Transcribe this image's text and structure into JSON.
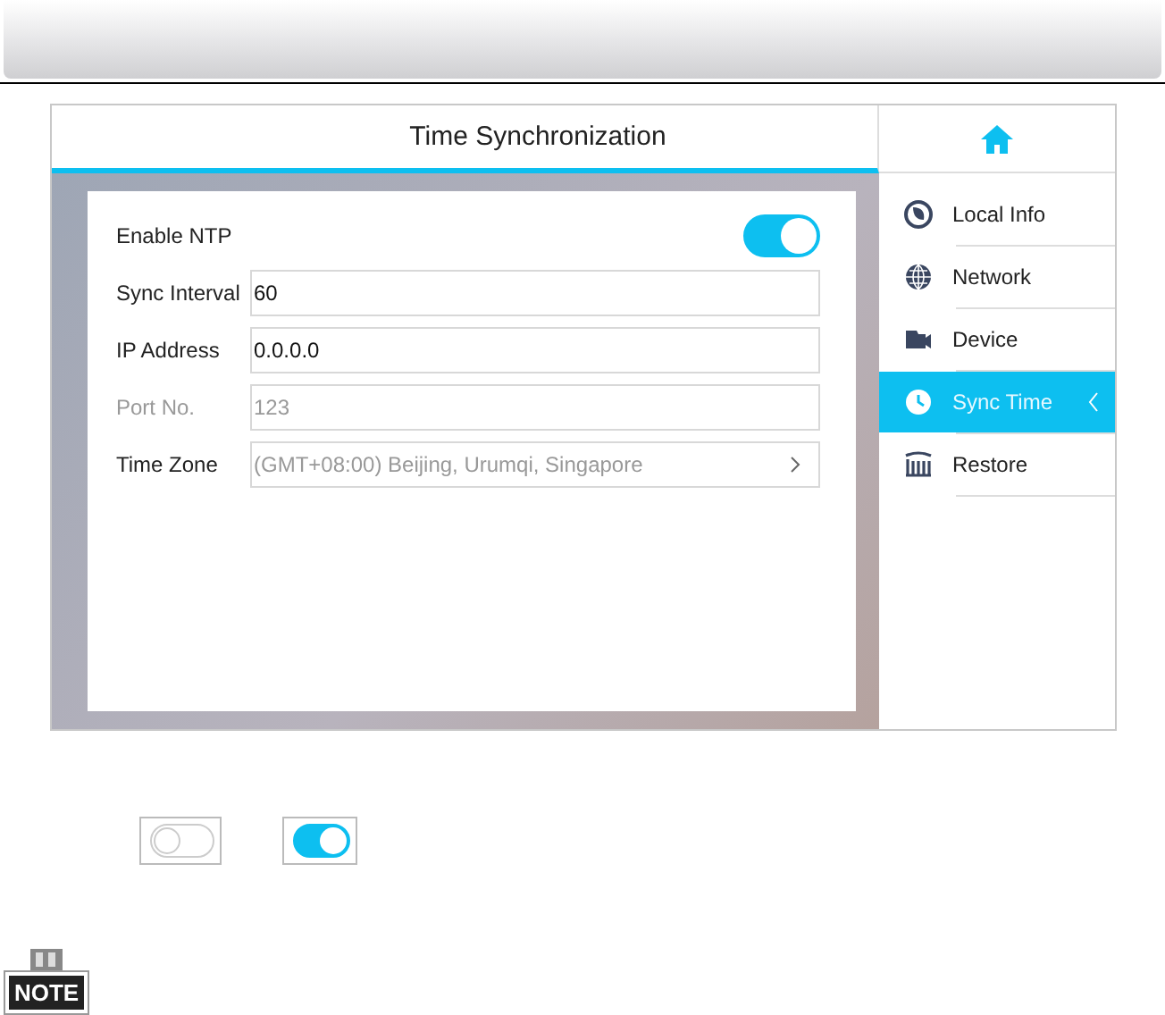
{
  "screen": {
    "title": "Time Synchronization",
    "form": [
      {
        "kind": "toggle",
        "label": "Enable NTP",
        "on": true,
        "disabled": false
      },
      {
        "kind": "input",
        "label": "Sync Interval",
        "value": "60",
        "disabled": false
      },
      {
        "kind": "input",
        "label": "IP Address",
        "value": "0.0.0.0",
        "disabled": false
      },
      {
        "kind": "input",
        "label": "Port No.",
        "value": "123",
        "disabled": true
      },
      {
        "kind": "select",
        "label": "Time Zone",
        "value": "(GMT+08:00) Beijing, Urumqi, Singapore",
        "disabled": false
      }
    ],
    "sidebar": {
      "items": [
        {
          "kind": "local",
          "label": "Local Info",
          "selected": false
        },
        {
          "kind": "network",
          "label": "Network",
          "selected": false
        },
        {
          "kind": "device",
          "label": "Device",
          "selected": false
        },
        {
          "kind": "clock",
          "label": "Sync Time",
          "selected": true
        },
        {
          "kind": "restore",
          "label": "Restore",
          "selected": false
        }
      ]
    }
  },
  "legend_toggles": [
    {
      "on": false
    },
    {
      "on": true
    }
  ],
  "note": {
    "label": "NOTE"
  }
}
